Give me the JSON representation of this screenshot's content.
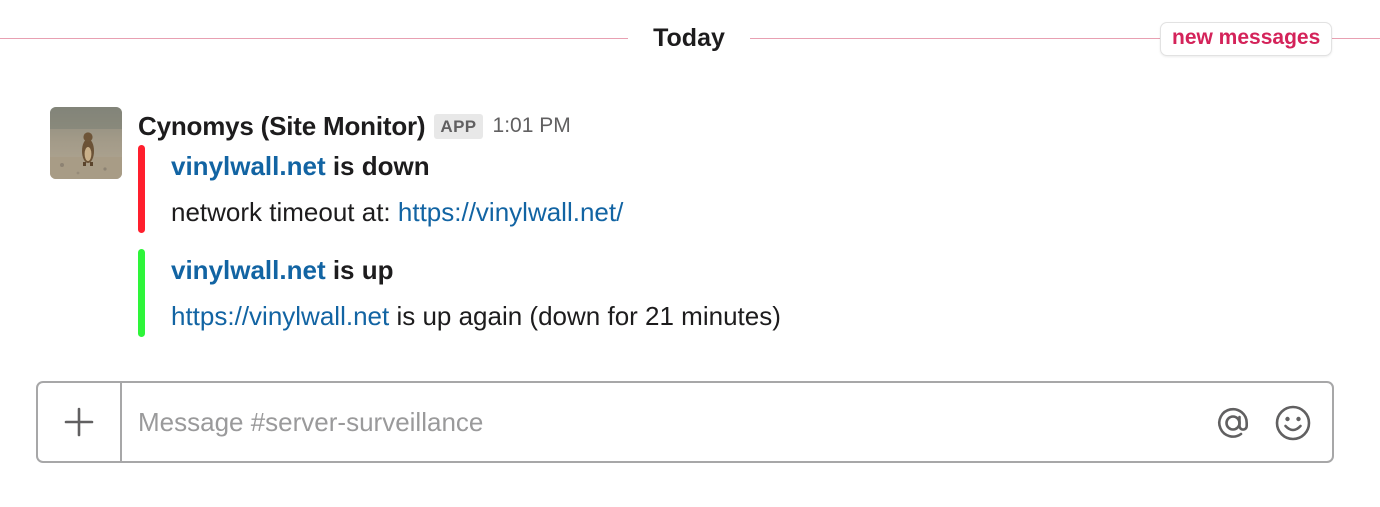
{
  "divider": {
    "label": "Today",
    "new_messages_label": "new messages",
    "line_color": "#e8a0b2",
    "new_messages_color": "#d4235a"
  },
  "message": {
    "sender": "Cynomys (Site Monitor)",
    "badge": "APP",
    "timestamp": "1:01 PM",
    "avatar_icon": "prairie-dog-avatar",
    "attachments": [
      {
        "status": "down",
        "bar_color": "#ff1f2d",
        "title_link": "vinylwall.net",
        "title_text": " is down",
        "body_prefix": "network timeout at: ",
        "body_link": "https://vinylwall.net/",
        "body_suffix": ""
      },
      {
        "status": "up",
        "bar_color": "#2ef53a",
        "title_link": "vinylwall.net",
        "title_text": " is up",
        "body_prefix": "",
        "body_link": "https://vinylwall.net",
        "body_suffix": " is up again (down for 21 minutes)"
      }
    ]
  },
  "composer": {
    "placeholder": "Message #server-surveillance",
    "value": "",
    "plus_icon": "plus-icon",
    "mention_icon": "at-icon",
    "emoji_icon": "emoji-icon"
  },
  "colors": {
    "link": "#1264a3",
    "text": "#1d1c1d",
    "muted": "#616061",
    "border": "#a7a7a8"
  }
}
